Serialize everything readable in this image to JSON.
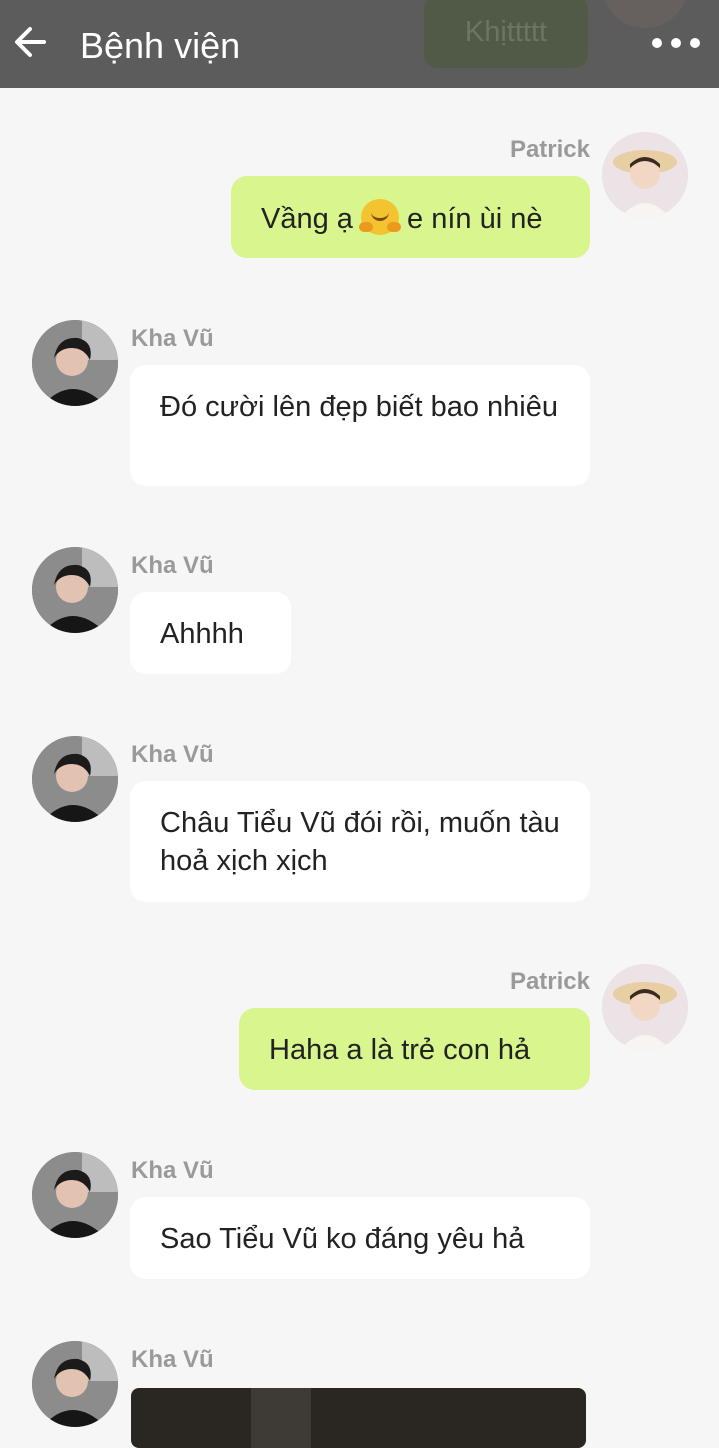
{
  "header": {
    "title": "Bệnh viện",
    "back_icon": "arrow-left-icon",
    "more_icon": "more-horizontal-icon",
    "ghost_text": "Khịttttt"
  },
  "messages": [
    {
      "sender": "Patrick",
      "side": "right",
      "text": "Vầng ạ",
      "emoji": "hugging-face",
      "text_after": "e nín ùi nè"
    },
    {
      "sender": "Kha Vũ",
      "side": "left",
      "text": "Đó cười lên đẹp biết bao nhiêu"
    },
    {
      "sender": "Kha Vũ",
      "side": "left",
      "text": "Ahhhh"
    },
    {
      "sender": "Kha Vũ",
      "side": "left",
      "text": "Châu Tiểu Vũ đói rồi, muốn tàu hoả xịch xịch"
    },
    {
      "sender": "Patrick",
      "side": "right",
      "text": "Haha a là trẻ con hả"
    },
    {
      "sender": "Kha Vũ",
      "side": "left",
      "text": "Sao Tiểu Vũ ko đáng yêu hả"
    },
    {
      "sender": "Kha Vũ",
      "side": "left",
      "type": "image"
    }
  ],
  "colors": {
    "header_bg": "#5c5c5c",
    "page_bg": "#f6f6f6",
    "my_bubble": "#d8f58e",
    "their_bubble": "#ffffff",
    "name_text": "#9a9a9a"
  }
}
